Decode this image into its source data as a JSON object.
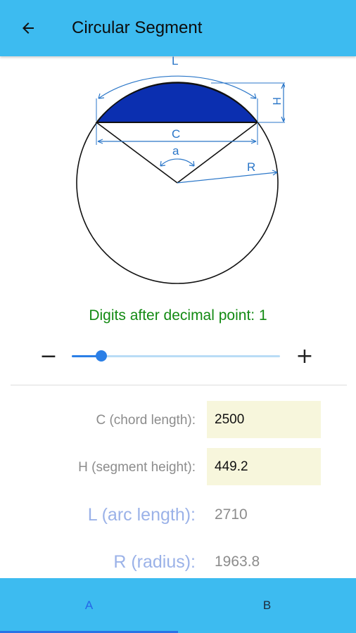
{
  "header": {
    "title": "Circular Segment",
    "back_icon": "arrow-left-icon"
  },
  "diagram": {
    "labels": {
      "arc": "L",
      "height": "H",
      "chord": "C",
      "angle": "a",
      "radius": "R"
    },
    "colors": {
      "segment_fill": "#0b2fb0",
      "dimension_lines": "#2a76c8",
      "circle": "#111111"
    }
  },
  "settings": {
    "digits_label": "Digits after decimal point: 1",
    "digits_value": 1,
    "minus_label": "−",
    "plus_label": "+"
  },
  "inputs": [
    {
      "label": "C (chord length):",
      "value": "2500"
    },
    {
      "label": "H (segment height):",
      "value": "449.2"
    }
  ],
  "results": [
    {
      "label": "L (arc length):",
      "value": "2710"
    },
    {
      "label": "R (radius):",
      "value": "1963.8"
    }
  ],
  "bottom_nav": {
    "tab_a": "A",
    "tab_b": "B",
    "active": "A"
  },
  "colors": {
    "app_bar": "#3dbbf0",
    "accent": "#2b7fe6",
    "digits_label": "#138a13",
    "input_bg": "#f7f6dc"
  }
}
